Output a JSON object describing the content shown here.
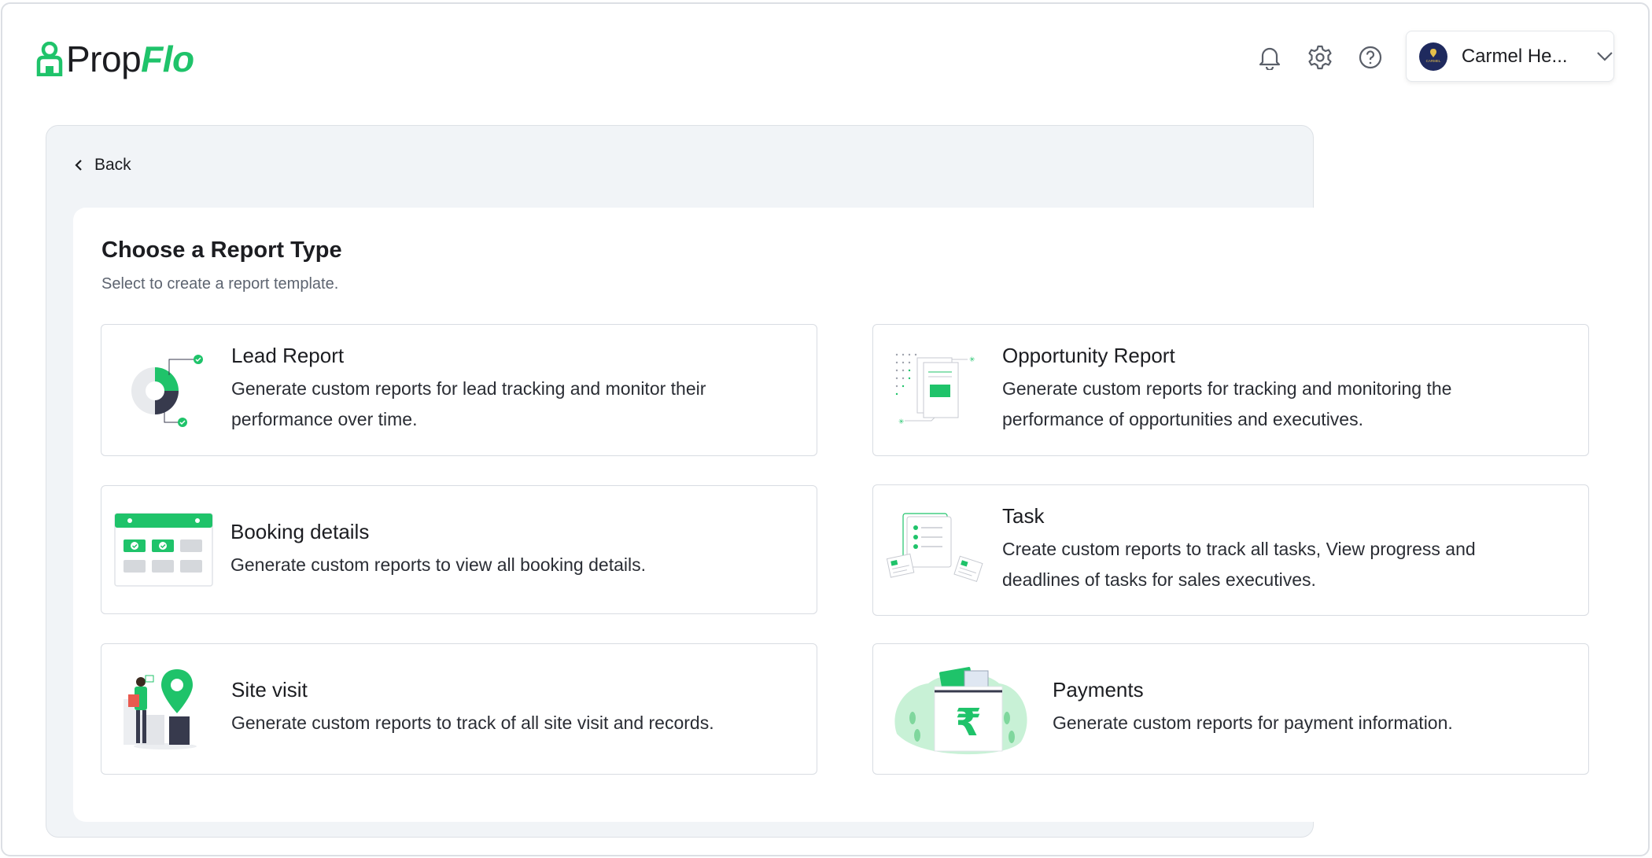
{
  "app": {
    "logo_text_prop": "Prop",
    "logo_text_flo": "Flo",
    "brand_color": "#1fc36a"
  },
  "header": {
    "icons": [
      "bell-icon",
      "gear-icon",
      "help-icon"
    ],
    "user": {
      "name": "Carmel He...",
      "avatar_caption": "CARMEL"
    }
  },
  "nav": {
    "back_label": "Back"
  },
  "page": {
    "title": "Choose a Report Type",
    "subtitle": "Select to create a report template."
  },
  "reports": [
    {
      "title": "Lead Report",
      "desc": "Generate custom reports for lead tracking and monitor their performance over time.",
      "icon": "pie-chart-illustration"
    },
    {
      "title": "Opportunity Report",
      "desc": "Generate custom reports for tracking and monitoring the performance of opportunities and executives.",
      "icon": "document-illustration"
    },
    {
      "title": "Booking details",
      "desc": "Generate custom reports to view all booking details.",
      "icon": "calendar-illustration"
    },
    {
      "title": "Task",
      "desc": "Create custom reports to track all tasks, View progress and deadlines of tasks  for sales executives.",
      "icon": "checklist-illustration"
    },
    {
      "title": "Site visit",
      "desc": "Generate custom reports to track of all site visit and records.",
      "icon": "location-pin-illustration"
    },
    {
      "title": "Payments",
      "desc": "Generate custom reports for payment information.",
      "icon": "rupee-wallet-illustration",
      "currency_symbol": "₹"
    }
  ]
}
